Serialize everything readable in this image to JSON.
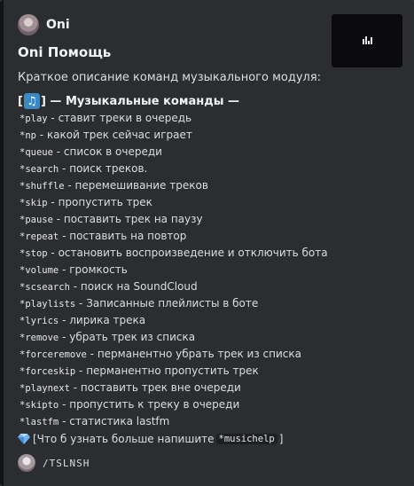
{
  "author": {
    "name": "Oni",
    "avatar_icon": "avatar-icon"
  },
  "embed": {
    "title": "Oni Помощь",
    "description": "Краткое описание команд музыкального модуля:",
    "accent_color": "#111214",
    "field_title": {
      "prefix": "[",
      "icon": "musical-notes-icon",
      "suffix": "] — Музыкальные команды —"
    },
    "commands": [
      {
        "cmd": "*play",
        "desc": "ставит треки в очередь"
      },
      {
        "cmd": "*np",
        "desc": "какой трек сейчас играет"
      },
      {
        "cmd": "*queue",
        "desc": "список в очереди"
      },
      {
        "cmd": "*search",
        "desc": "поиск треков."
      },
      {
        "cmd": "*shuffle",
        "desc": "перемешивание треков"
      },
      {
        "cmd": "*skip",
        "desc": "пропустить трек"
      },
      {
        "cmd": "*pause",
        "desc": "поставить трек на паузу"
      },
      {
        "cmd": "*repeat",
        "desc": "поставить на повтор"
      },
      {
        "cmd": "*stop",
        "desc": "остановить воспроизведение и отключить бота"
      },
      {
        "cmd": "*volume",
        "desc": "громкость"
      },
      {
        "cmd": "*scsearch",
        "desc": "поиск на SoundCloud"
      },
      {
        "cmd": "*playlists",
        "desc": "Записанные плейлисты в боте"
      },
      {
        "cmd": "*lyrics",
        "desc": "лирика трека"
      },
      {
        "cmd": "*remove",
        "desc": "убрать трек из списка"
      },
      {
        "cmd": "*forceremove",
        "desc": "перманентно убрать трек из списка"
      },
      {
        "cmd": "*forceskip",
        "desc": "перманентно пропустить трек"
      },
      {
        "cmd": "*playnext",
        "desc": "поставить трек вне очереди"
      },
      {
        "cmd": "*skipto",
        "desc": "пропустить к треку в очереди"
      },
      {
        "cmd": "*lastfm",
        "desc": "статистика lastfm"
      }
    ],
    "info": {
      "icon": "gem-icon",
      "prefix": "[Что б узнать больше напишите",
      "cmd": "*musichelp",
      "suffix": "]"
    },
    "footer": {
      "text": "/TSLNSH",
      "icon": "footer-avatar-icon"
    },
    "thumbnail": {
      "icon": "bar-chart-icon"
    }
  }
}
